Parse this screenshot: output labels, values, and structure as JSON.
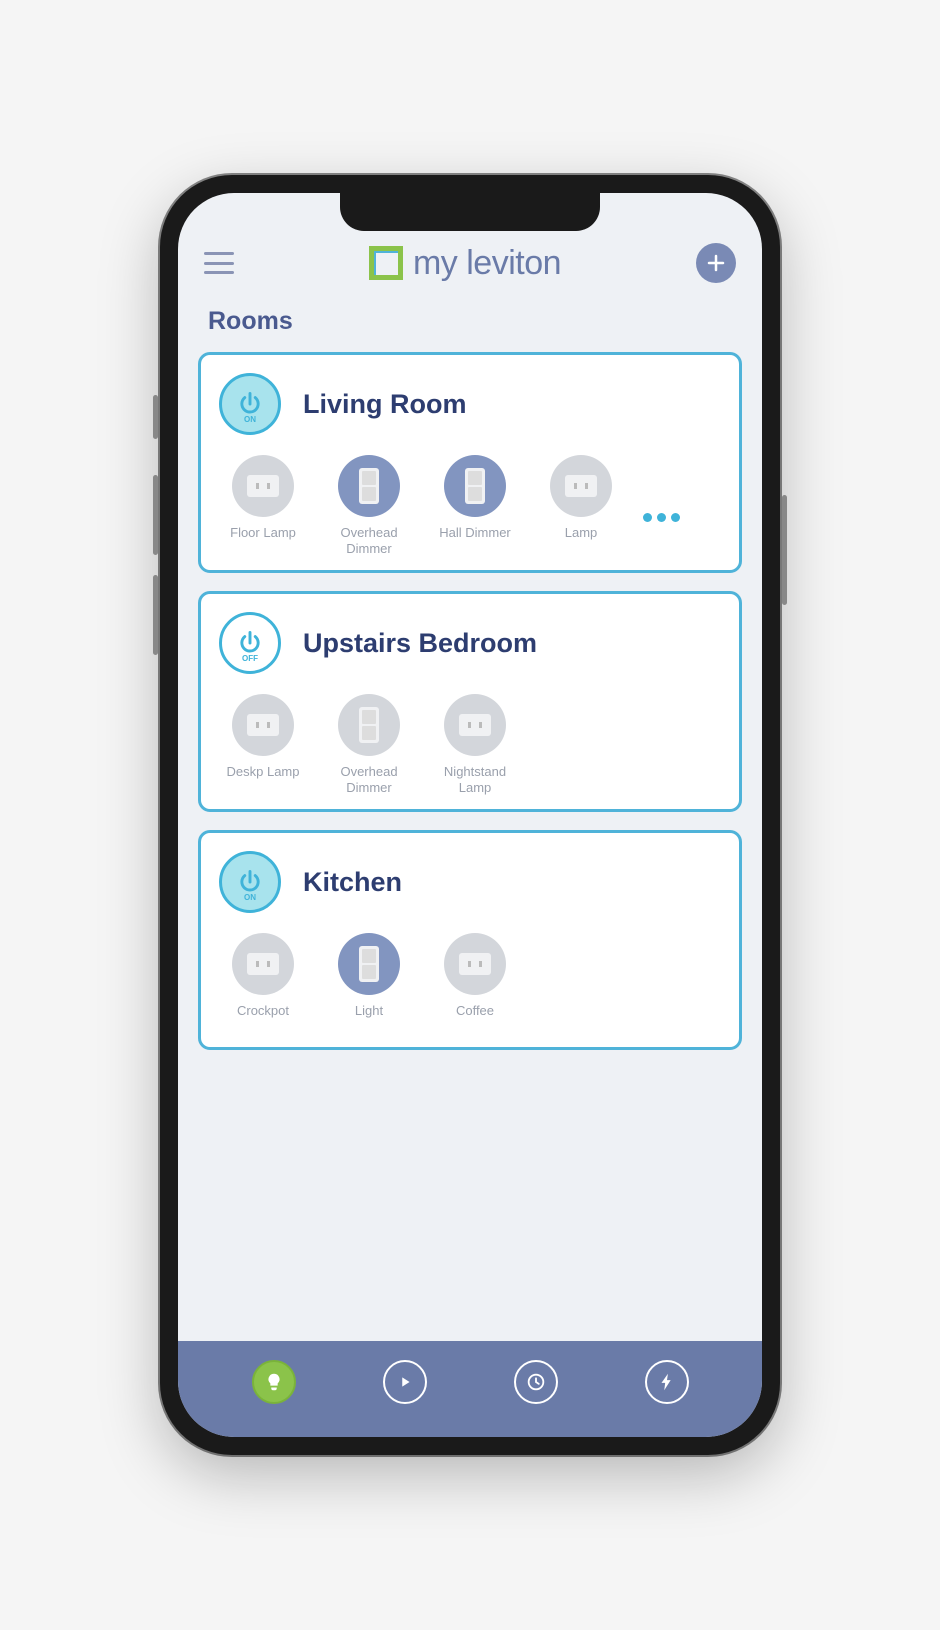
{
  "header": {
    "logo_text": "my leviton"
  },
  "section_title": "Rooms",
  "rooms": [
    {
      "name": "Living Room",
      "power_state": "ON",
      "devices": [
        {
          "label": "Floor Lamp",
          "type": "outlet",
          "on": false
        },
        {
          "label": "Overhead Dimmer",
          "type": "switch",
          "on": true
        },
        {
          "label": "Hall Dimmer",
          "type": "switch",
          "on": true
        },
        {
          "label": "Lamp",
          "type": "outlet",
          "on": false
        }
      ],
      "has_more": true
    },
    {
      "name": "Upstairs Bedroom",
      "power_state": "OFF",
      "devices": [
        {
          "label": "Deskp Lamp",
          "type": "outlet",
          "on": false
        },
        {
          "label": "Overhead Dimmer",
          "type": "switch",
          "on": false
        },
        {
          "label": "Nightstand Lamp",
          "type": "outlet",
          "on": false
        }
      ],
      "has_more": false
    },
    {
      "name": "Kitchen",
      "power_state": "ON",
      "devices": [
        {
          "label": "Crockpot",
          "type": "outlet",
          "on": false
        },
        {
          "label": "Light",
          "type": "switch",
          "on": true
        },
        {
          "label": "Coffee",
          "type": "outlet",
          "on": false
        }
      ],
      "has_more": false
    }
  ],
  "nav": {
    "items": [
      "lights",
      "play",
      "schedule",
      "energy"
    ],
    "active": "lights"
  }
}
